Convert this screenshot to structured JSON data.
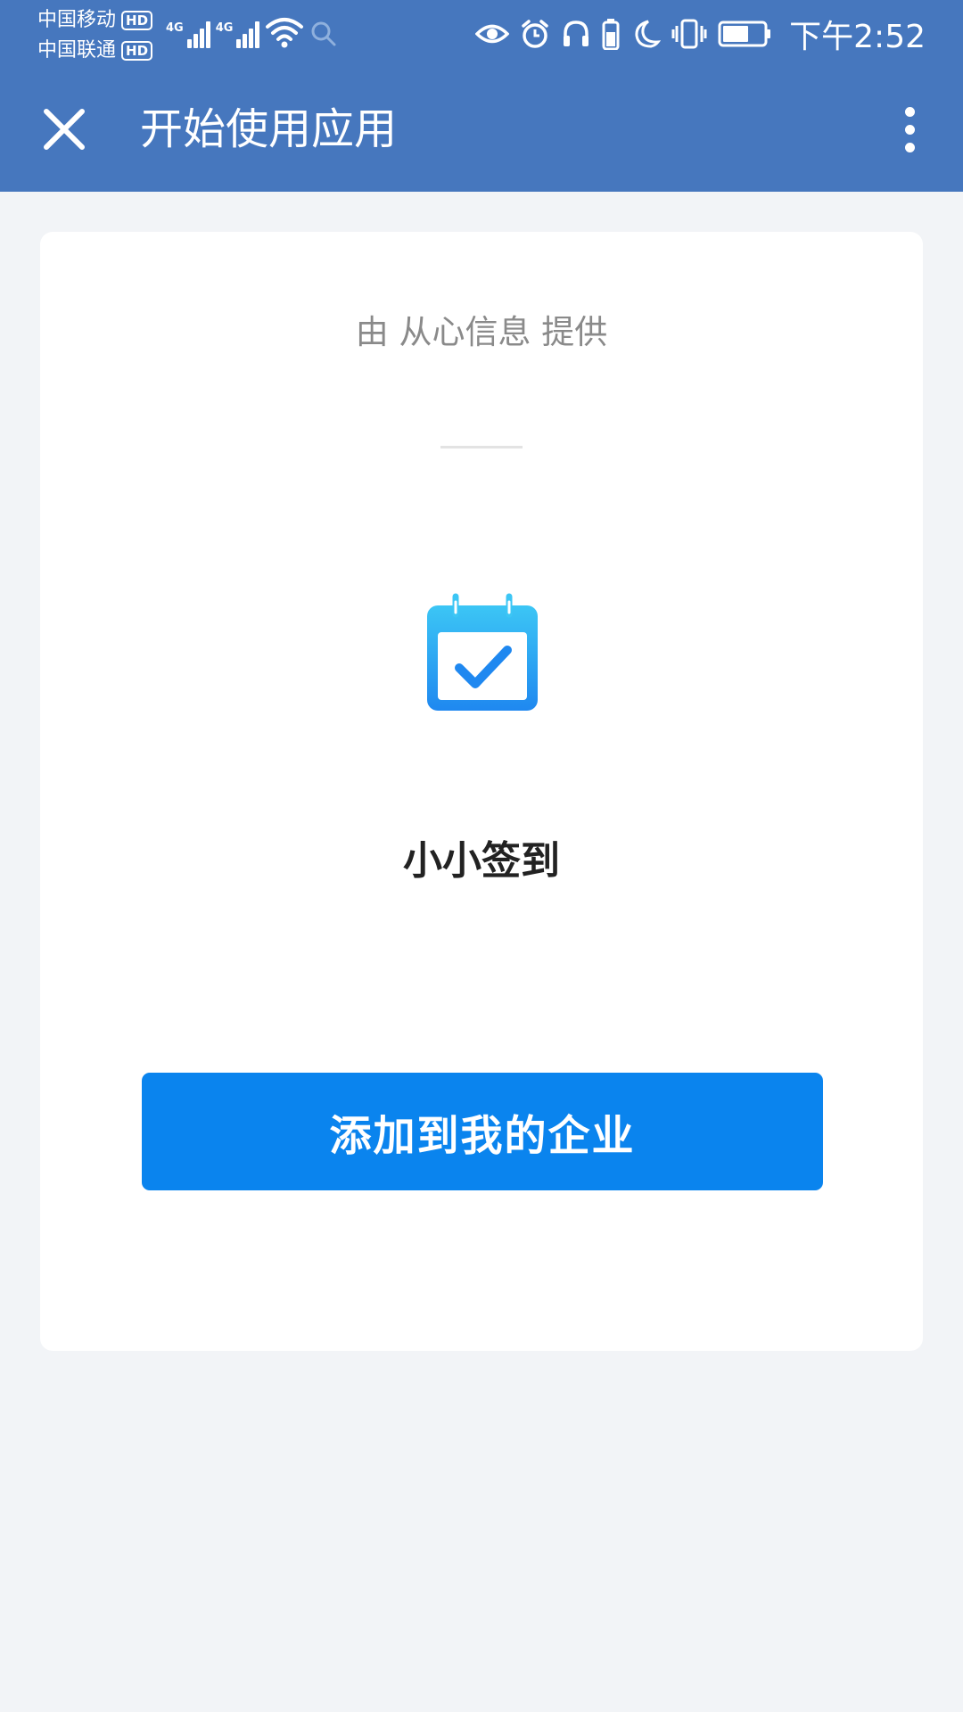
{
  "status_bar": {
    "carrier_1": "中国移动",
    "carrier_2": "中国联通",
    "hd_badge": "HD",
    "network_tag": "4G",
    "time": "下午2:52",
    "icons": [
      "eye-icon",
      "alarm-icon",
      "headphones-icon",
      "battery-saver-icon",
      "moon-icon",
      "vibrate-icon",
      "battery-icon"
    ]
  },
  "app_bar": {
    "title": "开始使用应用",
    "close_icon": "close-icon",
    "more_icon": "more-vertical-icon"
  },
  "card": {
    "provider": "由 从心信息 提供",
    "app_icon": "calendar-check-icon",
    "app_name": "小小签到",
    "add_button": "添加到我的企业"
  },
  "colors": {
    "header": "#4677be",
    "background": "#f2f4f7",
    "button": "#0a84ee",
    "icon_gradient_top": "#3cc6f5",
    "icon_gradient_bottom": "#1f88f0"
  }
}
